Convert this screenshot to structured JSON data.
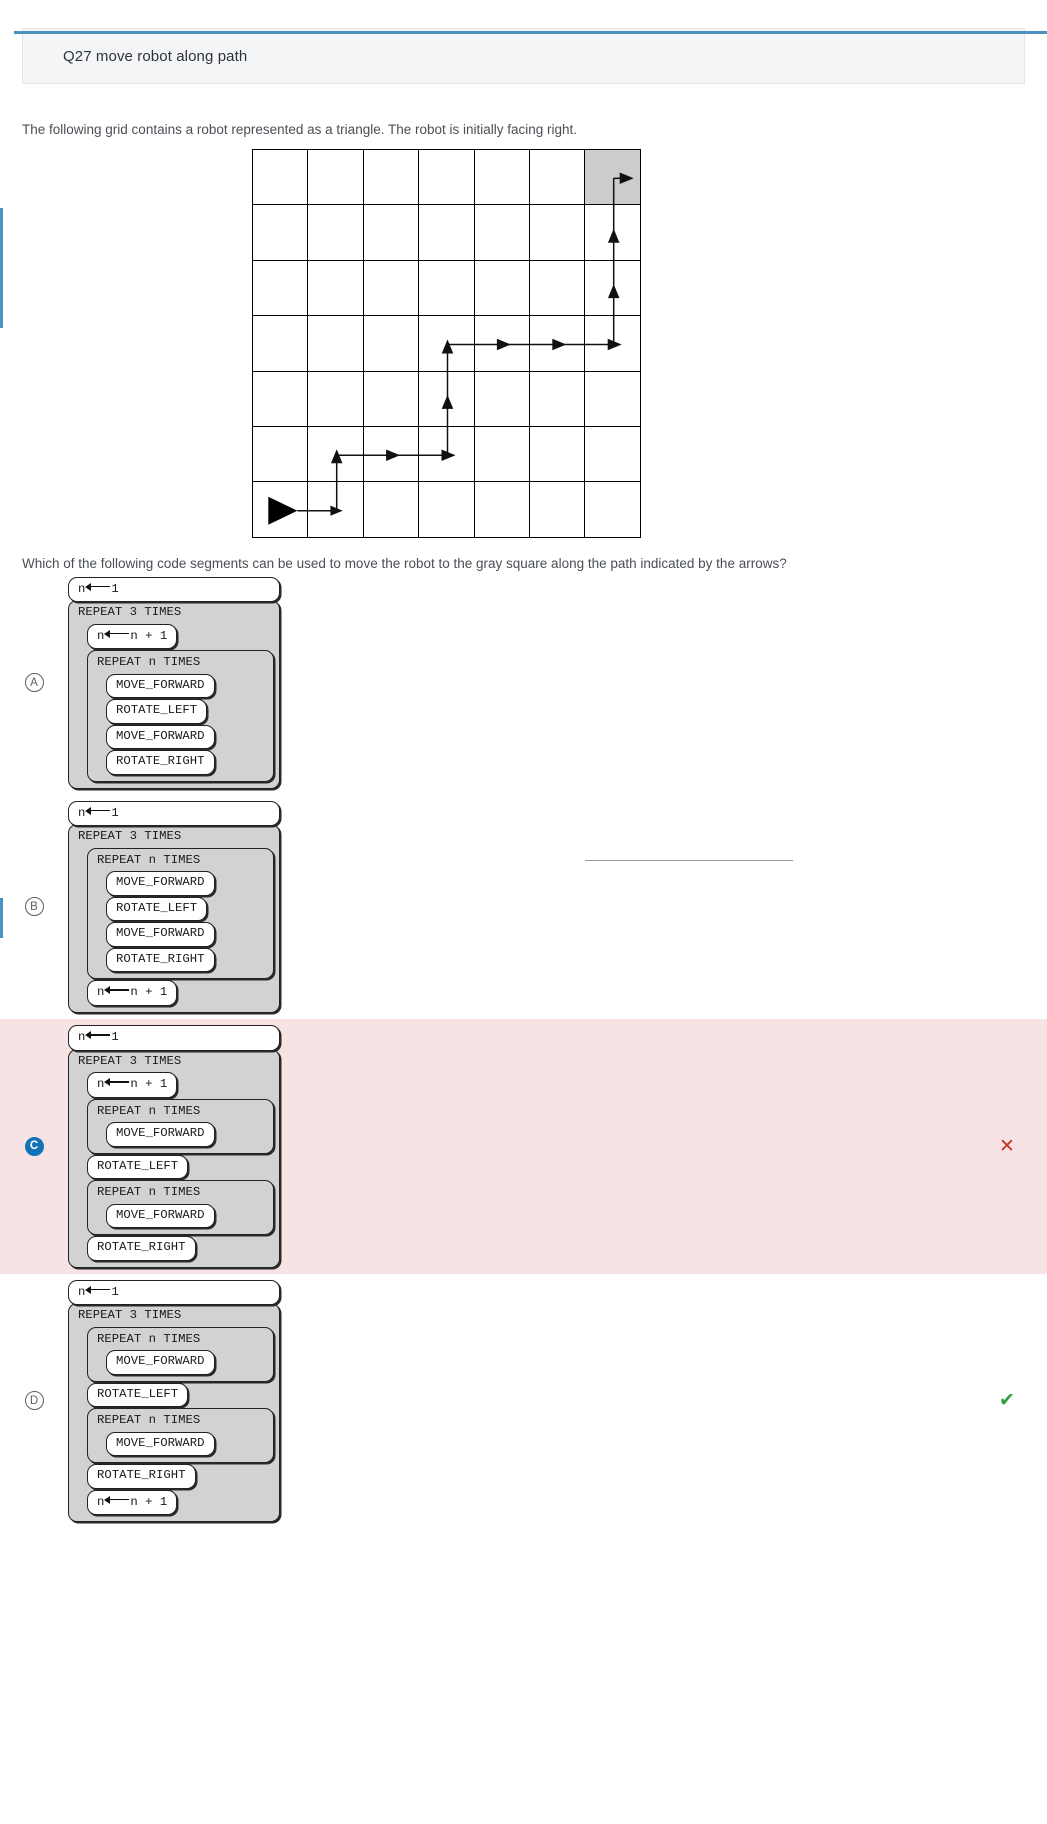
{
  "theme": {
    "accent": "#4a93bf",
    "selected_bubble": "#1273b7",
    "wrong_bg": "#f7e3e4",
    "goal_cell": "#cccccc",
    "loop_fill": "#d2d2d2"
  },
  "header": {
    "title": "Q27 move robot along path"
  },
  "prompts": {
    "intro": "The following grid contains a robot represented as a triangle. The robot is initially facing right.",
    "question": "Which of the following code segments can be used to move the robot to the gray square along the path indicated by the arrows?"
  },
  "grid": {
    "cols": 7,
    "rows": 7,
    "goal_cell": {
      "row": 0,
      "col": 6
    },
    "robot_start": {
      "row": 6,
      "col": 0,
      "facing": "right"
    },
    "path_description": "right 1, up 1, right 2, up 2, right 3, up 3 into gray square facing right"
  },
  "choices": [
    {
      "letter": "A",
      "selected": false,
      "state": "none",
      "mark": "",
      "lines": [
        {
          "kind": "stmt",
          "depth": 0,
          "text": "n",
          "arrow": true,
          "rhs": "1"
        },
        {
          "kind": "loop",
          "depth": 0,
          "text": "REPEAT 3 TIMES"
        },
        {
          "kind": "stmt",
          "depth": 1,
          "text": "n",
          "arrow": true,
          "rhs": "n + 1"
        },
        {
          "kind": "loop",
          "depth": 1,
          "text": "REPEAT n TIMES"
        },
        {
          "kind": "stmt",
          "depth": 2,
          "text": "MOVE_FORWARD"
        },
        {
          "kind": "stmt",
          "depth": 2,
          "text": "ROTATE_LEFT"
        },
        {
          "kind": "stmt",
          "depth": 2,
          "text": "MOVE_FORWARD"
        },
        {
          "kind": "stmt",
          "depth": 2,
          "text": "ROTATE_RIGHT"
        }
      ]
    },
    {
      "letter": "B",
      "selected": false,
      "state": "none",
      "mark": "",
      "lines": [
        {
          "kind": "stmt",
          "depth": 0,
          "text": "n",
          "arrow": true,
          "rhs": "1"
        },
        {
          "kind": "loop",
          "depth": 0,
          "text": "REPEAT 3 TIMES"
        },
        {
          "kind": "loop",
          "depth": 1,
          "text": "REPEAT n TIMES"
        },
        {
          "kind": "stmt",
          "depth": 2,
          "text": "MOVE_FORWARD"
        },
        {
          "kind": "stmt",
          "depth": 2,
          "text": "ROTATE_LEFT"
        },
        {
          "kind": "stmt",
          "depth": 2,
          "text": "MOVE_FORWARD"
        },
        {
          "kind": "stmt",
          "depth": 2,
          "text": "ROTATE_RIGHT"
        },
        {
          "kind": "stmt",
          "depth": 1,
          "text": "n",
          "arrow": true,
          "rhs": "n + 1"
        }
      ]
    },
    {
      "letter": "C",
      "selected": true,
      "state": "wrong",
      "mark": "✕",
      "lines": [
        {
          "kind": "stmt",
          "depth": 0,
          "text": "n",
          "arrow": true,
          "rhs": "1"
        },
        {
          "kind": "loop",
          "depth": 0,
          "text": "REPEAT 3 TIMES"
        },
        {
          "kind": "stmt",
          "depth": 1,
          "text": "n",
          "arrow": true,
          "rhs": "n + 1"
        },
        {
          "kind": "loop",
          "depth": 1,
          "text": "REPEAT n TIMES"
        },
        {
          "kind": "stmt",
          "depth": 2,
          "text": "MOVE_FORWARD"
        },
        {
          "kind": "stmt",
          "depth": 1,
          "text": "ROTATE_LEFT"
        },
        {
          "kind": "loop",
          "depth": 1,
          "text": "REPEAT n TIMES"
        },
        {
          "kind": "stmt",
          "depth": 2,
          "text": "MOVE_FORWARD"
        },
        {
          "kind": "stmt",
          "depth": 1,
          "text": "ROTATE_RIGHT"
        }
      ]
    },
    {
      "letter": "D",
      "selected": false,
      "state": "correct",
      "mark": "✔",
      "lines": [
        {
          "kind": "stmt",
          "depth": 0,
          "text": "n",
          "arrow": true,
          "rhs": "1"
        },
        {
          "kind": "loop",
          "depth": 0,
          "text": "REPEAT 3 TIMES"
        },
        {
          "kind": "loop",
          "depth": 1,
          "text": "REPEAT n TIMES"
        },
        {
          "kind": "stmt",
          "depth": 2,
          "text": "MOVE_FORWARD"
        },
        {
          "kind": "stmt",
          "depth": 1,
          "text": "ROTATE_LEFT"
        },
        {
          "kind": "loop",
          "depth": 1,
          "text": "REPEAT n TIMES"
        },
        {
          "kind": "stmt",
          "depth": 2,
          "text": "MOVE_FORWARD"
        },
        {
          "kind": "stmt",
          "depth": 1,
          "text": "ROTATE_RIGHT"
        },
        {
          "kind": "stmt",
          "depth": 1,
          "text": "n",
          "arrow": true,
          "rhs": "n + 1"
        }
      ]
    }
  ]
}
